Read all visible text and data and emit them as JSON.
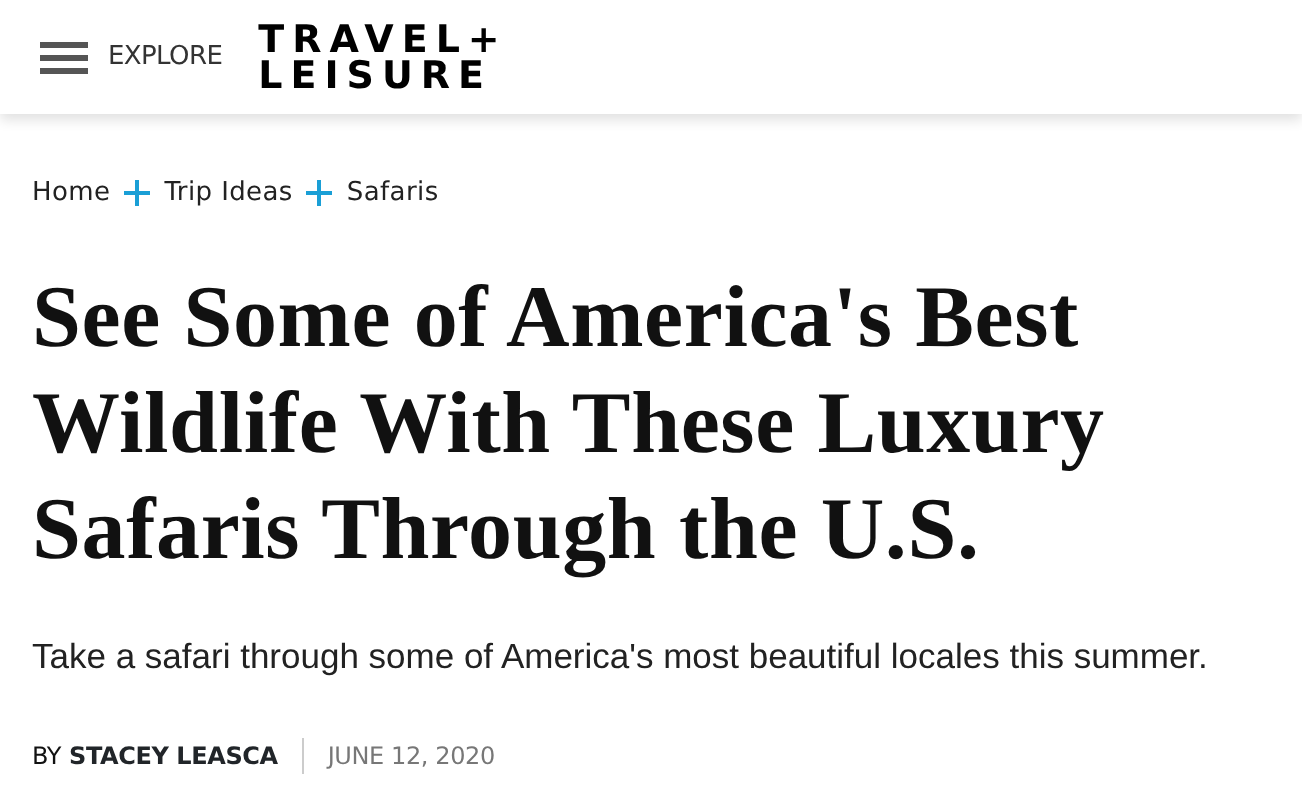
{
  "header": {
    "menu_label": "EXPLORE",
    "logo_lines": [
      "TRAVEL+",
      "LEISURE"
    ]
  },
  "breadcrumbs": [
    {
      "label": "Home"
    },
    {
      "label": "Trip Ideas"
    },
    {
      "label": "Safaris"
    }
  ],
  "article": {
    "title": "See Some of America's Best Wildlife With These Luxury Safaris Through the U.S.",
    "subtitle": "Take a safari through some of America's most beautiful locales this summer.",
    "byline": {
      "prefix": "BY",
      "author": "STACEY LEASCA",
      "date": "JUNE 12, 2020"
    }
  }
}
